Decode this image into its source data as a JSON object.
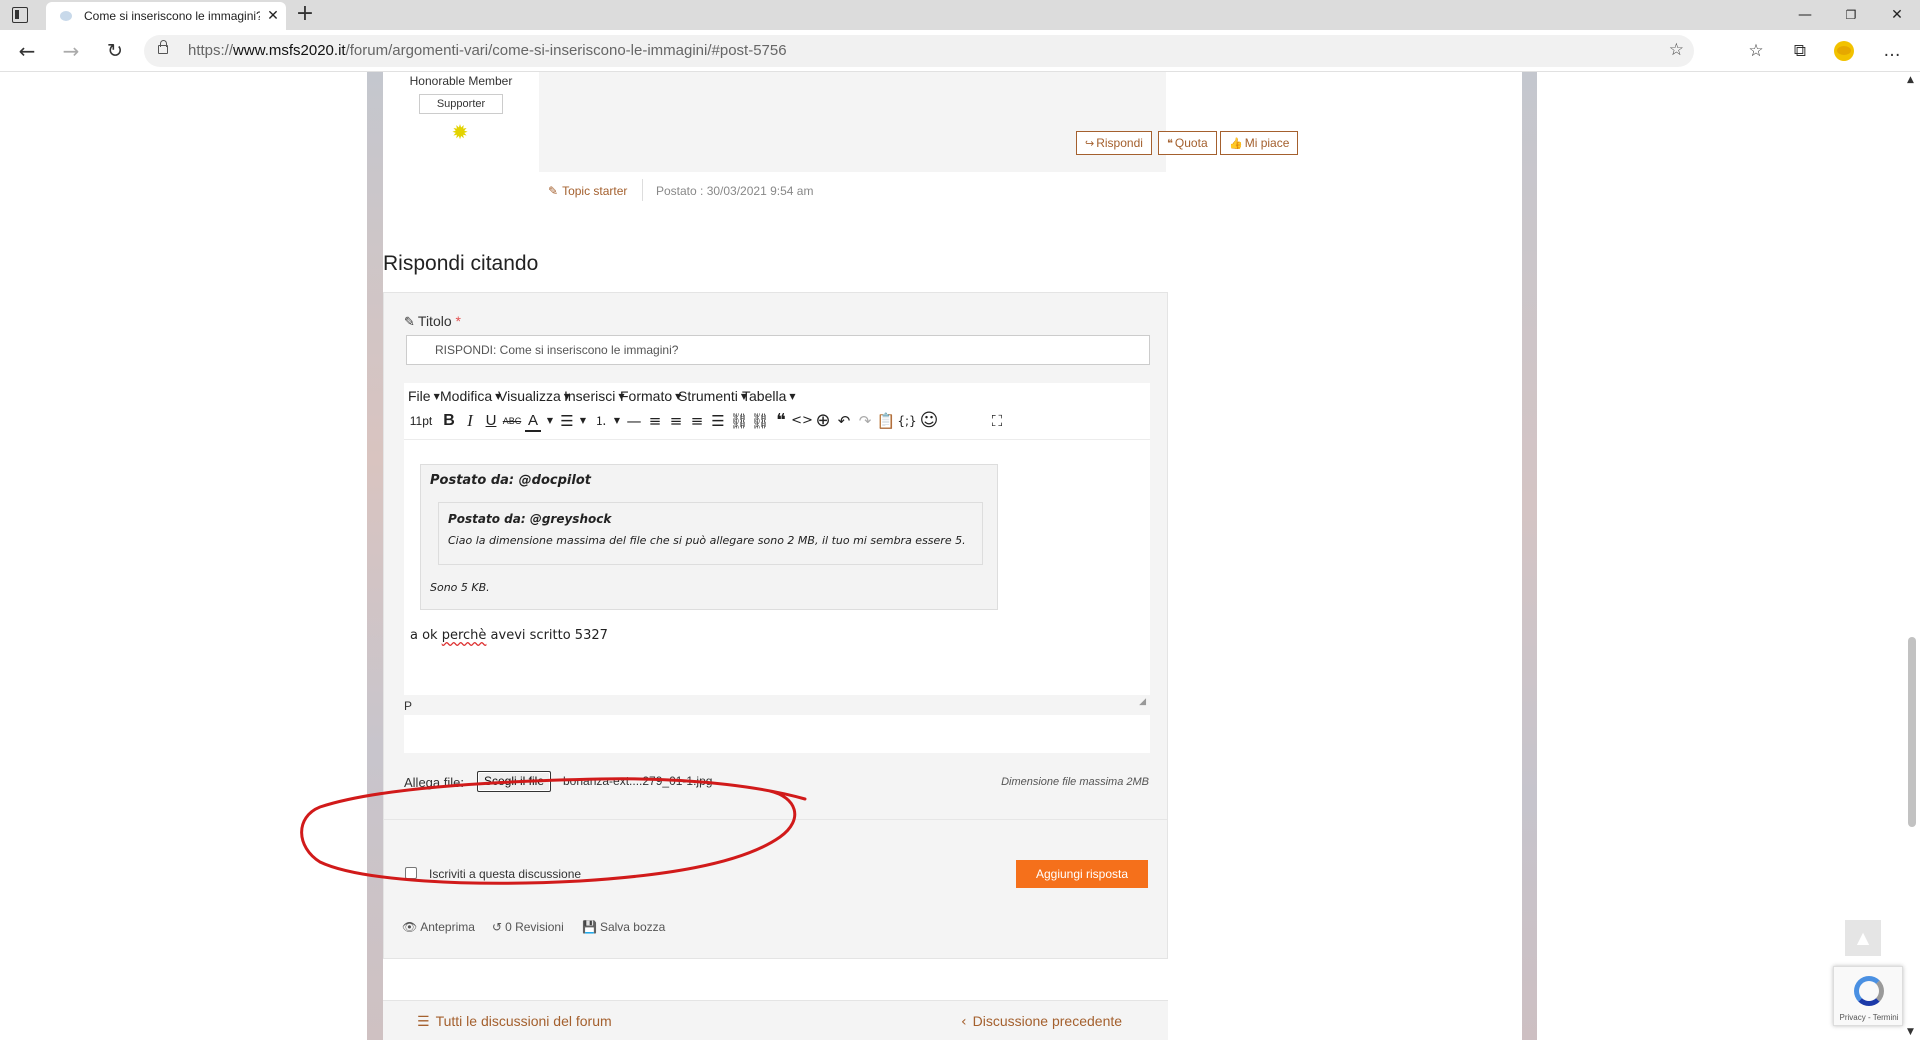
{
  "browser": {
    "tab_title": "Come si inseriscono le immagini?",
    "tab_close": "✕",
    "new_tab": "+",
    "url_prefix": "https://",
    "url_host": "www.msfs2020.it",
    "url_path": "/forum/argomenti-vari/come-si-inseriscono-le-immagini/#post-5756",
    "window_controls": [
      "—",
      "❐",
      "✕"
    ]
  },
  "post": {
    "author_rank": "Honorable Member",
    "author_badge": "Supporter",
    "buttons": {
      "reply": "Rispondi",
      "quote": "Quota",
      "like": "Mi piace"
    },
    "topic_starter": "Topic starter",
    "date": "Postato : 30/03/2021 9:54 am"
  },
  "reply": {
    "heading": "Rispondi citando",
    "title_label": "Titolo",
    "required_mark": "*",
    "title_value": "RISPONDI: Come si inseriscono le immagini?",
    "menu": [
      "File",
      "Modifica",
      "Visualizza",
      "Inserisci",
      "Formato",
      "Strumenti",
      "Tabella"
    ],
    "font_size": "11pt",
    "outer_quote_title": "Postato da: @docpilot",
    "inner_quote_title": "Postato da: @greyshock",
    "inner_quote_text": "Ciao la dimensione massima del file che si può allegare sono 2 MB, il tuo mi sembra essere 5.",
    "outer_quote_text": "Sono 5 KB.",
    "body_before": "a ok ",
    "body_misspelled": "perchè",
    "body_after": " avevi scritto 5327",
    "status_path": "P",
    "attach_label": "Allega file:",
    "attach_button": "Scegli il file",
    "attach_filename": "bonanza-ext....279_01-1.jpg",
    "attach_max": "Dimensione file massima 2MB",
    "subscribe_label": "Iscriviti a questa discussione",
    "subscribe_checked": false,
    "submit": "Aggiungi risposta",
    "preview": "Anteprima",
    "revisions": "0 Revisioni",
    "save_draft": "Salva bozza"
  },
  "forum_nav": {
    "all_discussions": "Tutti le discussioni del forum",
    "previous": "Discussione precedente"
  },
  "recaptcha": {
    "text": "Privacy - Termini"
  },
  "colors": {
    "accent": "#a4602e",
    "submit": "#f5701b",
    "annotation": "#d11a1a"
  }
}
